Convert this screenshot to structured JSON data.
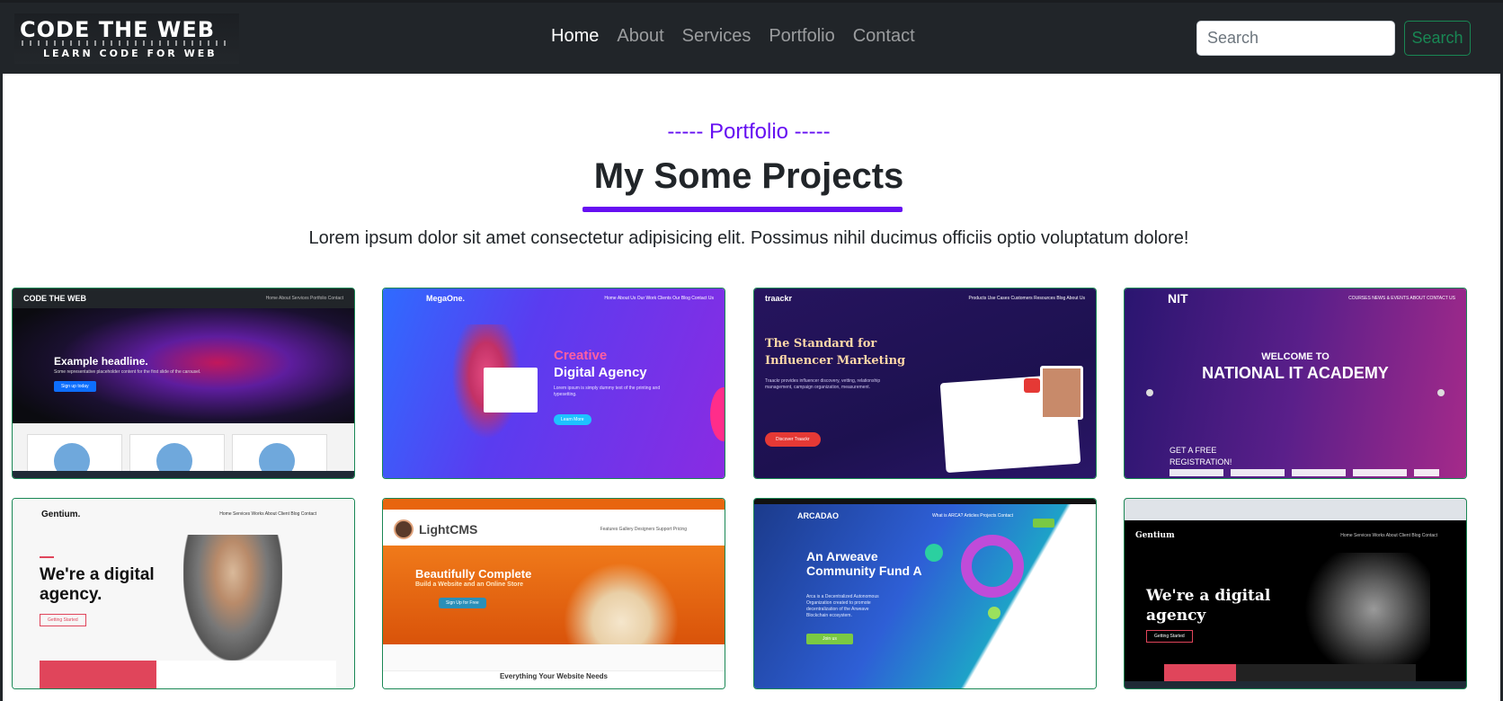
{
  "navbar": {
    "brand_title": "CODE THE WEB",
    "brand_subtitle": "LEARN CODE FOR WEB",
    "links": [
      "Home",
      "About",
      "Services",
      "Portfolio",
      "Contact"
    ],
    "active_link": "Home",
    "search_placeholder": "Search",
    "search_button": "Search"
  },
  "portfolio": {
    "tag": "----- Portfolio -----",
    "title": "My Some Projects",
    "description": "Lorem ipsum dolor sit amet consectetur adipisicing elit. Possimus nihil ducimus officiis optio voluptatum dolore!",
    "accent_color": "#6610f2",
    "projects": [
      {
        "logo": "CODE THE WEB",
        "menu": "Home  About  Services  Portfolio  Contact",
        "headline": "Example headline.",
        "text": "Some representative placeholder content for the first slide of the carousel.",
        "button": "Sign up today"
      },
      {
        "logo": "MegaOne.",
        "menu": "Home  About Us  Our Work  Clients  Our Blog  Contact Us",
        "headline": "Creative",
        "headline2": "Digital Agency",
        "text": "Lorem ipsum is simply dummy text of the printing and typesetting.",
        "button": "Learn More"
      },
      {
        "logo": "traackr",
        "menu": "Products  Use Cases  Customers  Resources  Blog  About Us",
        "headline": "The Standard for",
        "headline2": "Influencer Marketing",
        "text": "Traackr provides influencer discovery, vetting, relationship management, campaign organization, measurement.",
        "button": "Discover Traackr"
      },
      {
        "logo": "NIT",
        "menu": "COURSES  NEWS & EVENTS  ABOUT  CONTACT US",
        "headline": "WELCOME TO",
        "headline2": "NATIONAL IT ACADEMY",
        "text": "GET A FREE REGISTRATION!",
        "button": ""
      },
      {
        "logo": "Gentium.",
        "menu": "Home  Services  Works  About  Client  Blog  Contact",
        "headline": "We're a digital",
        "headline2": "agency.",
        "text": "",
        "button": "Getting Started"
      },
      {
        "logo": "LightCMS",
        "menu": "Features  Gallery  Designers  Support  Pricing",
        "headline": "Beautifully Complete",
        "headline2": "Build a Website and an Online Store",
        "text": "Everything Your Website Needs",
        "button": "Sign Up for Free"
      },
      {
        "logo": "ARCADAO",
        "menu": "What is ARCA?  Articles  Projects  Contact",
        "headline": "An Arweave",
        "headline2": "Community Fund A",
        "text": "Arca is a Decentralized Autonomous Organization created to promote decentralization of the Arweave Blockchain ecosystem.",
        "button": "Join us"
      },
      {
        "logo": "Gentium",
        "menu": "Home  Services  Works  About  Client  Blog  Contact",
        "headline": "We're a digital",
        "headline2": "agency",
        "text": "",
        "button": "Getting Started"
      }
    ]
  }
}
